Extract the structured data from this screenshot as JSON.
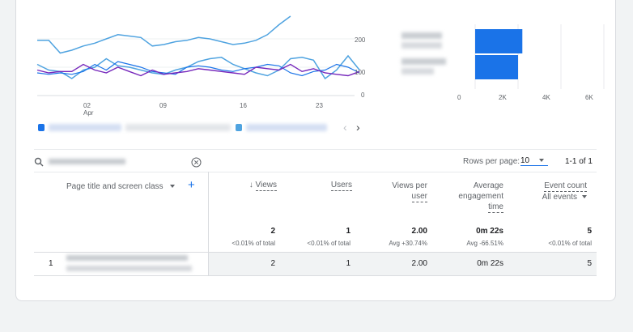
{
  "colors": {
    "blue": "#1a73e8",
    "purple": "#7627bb",
    "light_blue": "#4fa3e0",
    "bar": "#1a73e8"
  },
  "line_chart": {
    "x_ticks": [
      {
        "day": "02",
        "month": "Apr"
      },
      {
        "day": "09"
      },
      {
        "day": "16"
      },
      {
        "day": "23"
      }
    ],
    "y_ticks": [
      "200",
      "100",
      "0"
    ]
  },
  "chart_data": [
    {
      "type": "line",
      "x": [
        1,
        2,
        3,
        4,
        5,
        6,
        7,
        8,
        9,
        10,
        11,
        12,
        13,
        14,
        15,
        16,
        17,
        18,
        19,
        20,
        21,
        22,
        23,
        24,
        25,
        26,
        27,
        28
      ],
      "ylim": [
        0,
        200
      ],
      "series": [
        {
          "values": [
            195,
            195,
            150,
            160,
            175,
            185,
            200,
            215,
            210,
            205,
            175,
            180,
            190,
            195,
            205,
            200,
            190,
            180,
            185,
            195,
            215,
            250,
            280
          ]
        },
        {
          "values": [
            110,
            90,
            85,
            60,
            90,
            100,
            130,
            105,
            100,
            90,
            80,
            75,
            90,
            100,
            120,
            130,
            135,
            110,
            95,
            80,
            70,
            90,
            130,
            135,
            125,
            60,
            90,
            140,
            90
          ]
        },
        {
          "values": [
            80,
            75,
            80,
            75,
            85,
            110,
            90,
            120,
            110,
            100,
            85,
            80,
            75,
            100,
            105,
            100,
            90,
            85,
            95,
            100,
            110,
            105,
            80,
            70,
            85,
            90,
            110,
            100,
            80
          ]
        },
        {
          "values": [
            90,
            80,
            85,
            85,
            110,
            90,
            80,
            100,
            85,
            70,
            90,
            75,
            80,
            85,
            95,
            90,
            85,
            80,
            75,
            100,
            95,
            90,
            110,
            85,
            95,
            80,
            75,
            70,
            85
          ]
        }
      ]
    },
    {
      "type": "bar",
      "orientation": "horizontal",
      "values": [
        2200,
        2000
      ],
      "xlim": [
        0,
        6000
      ],
      "x_ticks": [
        "0",
        "2K",
        "4K",
        "6K"
      ]
    }
  ],
  "pager": {
    "prev": "‹",
    "next": "›"
  },
  "toolbar": {
    "rows_per_page_label": "Rows per page:",
    "rows_per_page_value": "10",
    "range_text": "1-1 of 1"
  },
  "table": {
    "dimension_header": "Page title and screen class",
    "add_icon": "+",
    "columns": {
      "views": {
        "label": "Views",
        "sort": "↓",
        "total": "2",
        "sub": "<0.01% of total",
        "row": "2"
      },
      "users": {
        "label": "Users",
        "total": "1",
        "sub": "<0.01% of total",
        "row": "1"
      },
      "views_per_user": {
        "line1": "Views per",
        "line2": "user",
        "total": "2.00",
        "sub": "Avg +30.74%",
        "row": "2.00"
      },
      "avg_engagement": {
        "line1": "Average",
        "line2": "engagement",
        "line3": "time",
        "total": "0m 22s",
        "sub": "Avg -66.51%",
        "row": "0m 22s"
      },
      "event_count": {
        "label": "Event count",
        "filter": "All events",
        "total": "5",
        "sub": "<0.01% of total",
        "row": "5"
      }
    },
    "row_index": "1"
  }
}
